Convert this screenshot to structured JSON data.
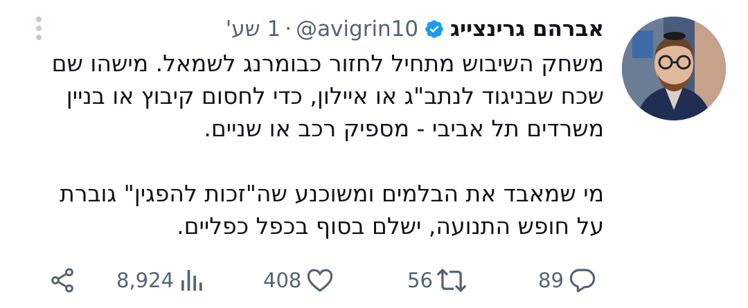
{
  "author": {
    "name": "אברהם גרינצייג",
    "handle": "@avigrin10",
    "verified": true
  },
  "meta": {
    "separator": "·",
    "time": "1 שע'"
  },
  "body": {
    "paragraph1": [
      "משחק השיבוש מתחיל לחזור כבומרנג לשמאל. מישהו שם",
      "שכח שבניגוד לנתב\"ג או איילון, כדי לחסום קיבוץ או בניין",
      "משרדים תל אביבי - מספיק רכב או שניים."
    ],
    "paragraph2": [
      "מי שמאבד את הבלמים ומשוכנע שה\"זכות להפגין\" גוברת",
      "על חופש התנועה, ישלם בסוף בכפל כפליים."
    ]
  },
  "actions": {
    "replies": "89",
    "retweets": "56",
    "likes": "408",
    "views": "8,924"
  },
  "colors": {
    "text": "#0f1419",
    "muted": "#536471",
    "verified": "#1d9bf0"
  },
  "icons": [
    "more-icon",
    "verified-badge-icon",
    "reply-icon",
    "retweet-icon",
    "like-icon",
    "views-icon",
    "share-icon"
  ]
}
